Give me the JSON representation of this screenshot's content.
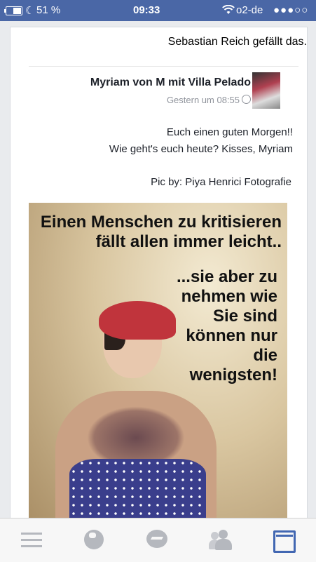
{
  "status_bar": {
    "battery_pct": "51 %",
    "time": "09:33",
    "carrier": "o2-de",
    "signal": "●●●○○"
  },
  "post": {
    "liked_by": "Sebastian Reich gefällt das.",
    "author": "Myriam von M mit Villa Pelado",
    "timestamp": "Gestern um 08:55",
    "message_lines": [
      "Euch einen guten Morgen!!",
      "Wie geht's euch heute? Kisses, Myriam"
    ],
    "credit": "Pic by: Piya Henrici Fotografie",
    "image_text_top": "Einen Menschen zu kritisieren fällt allen immer leicht..",
    "image_text_side": "...sie aber zu nehmen wie Sie sind können nur die wenigsten!"
  },
  "nav": {
    "items": [
      "menu-icon",
      "globe-icon",
      "messenger-icon",
      "friends-icon",
      "news-feed-icon"
    ],
    "active": "news-feed-icon",
    "active_color": "#4267b2",
    "inactive_color": "#b5b8be"
  },
  "colors": {
    "status_bar": "#4a67a6",
    "background": "#e9ebee"
  }
}
